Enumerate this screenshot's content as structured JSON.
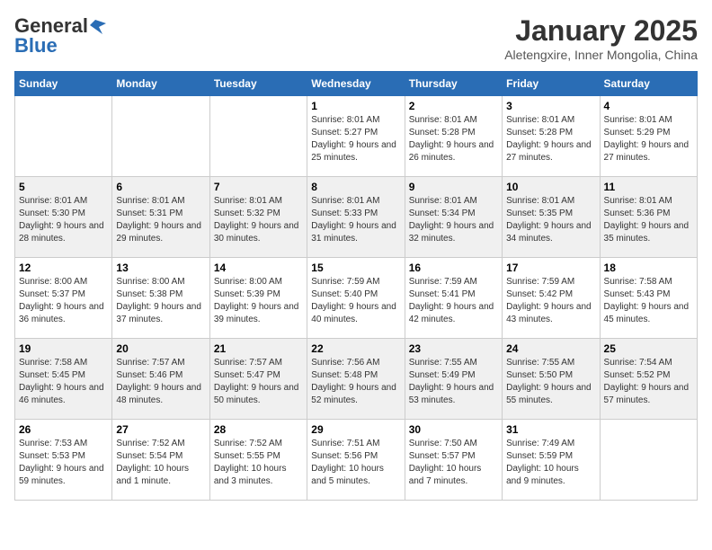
{
  "header": {
    "logo_general": "General",
    "logo_blue": "Blue",
    "title": "January 2025",
    "subtitle": "Aletengxire, Inner Mongolia, China"
  },
  "weekdays": [
    "Sunday",
    "Monday",
    "Tuesday",
    "Wednesday",
    "Thursday",
    "Friday",
    "Saturday"
  ],
  "weeks": [
    [
      {
        "day": "",
        "sunrise": "",
        "sunset": "",
        "daylight": ""
      },
      {
        "day": "",
        "sunrise": "",
        "sunset": "",
        "daylight": ""
      },
      {
        "day": "",
        "sunrise": "",
        "sunset": "",
        "daylight": ""
      },
      {
        "day": "1",
        "sunrise": "Sunrise: 8:01 AM",
        "sunset": "Sunset: 5:27 PM",
        "daylight": "Daylight: 9 hours and 25 minutes."
      },
      {
        "day": "2",
        "sunrise": "Sunrise: 8:01 AM",
        "sunset": "Sunset: 5:28 PM",
        "daylight": "Daylight: 9 hours and 26 minutes."
      },
      {
        "day": "3",
        "sunrise": "Sunrise: 8:01 AM",
        "sunset": "Sunset: 5:28 PM",
        "daylight": "Daylight: 9 hours and 27 minutes."
      },
      {
        "day": "4",
        "sunrise": "Sunrise: 8:01 AM",
        "sunset": "Sunset: 5:29 PM",
        "daylight": "Daylight: 9 hours and 27 minutes."
      }
    ],
    [
      {
        "day": "5",
        "sunrise": "Sunrise: 8:01 AM",
        "sunset": "Sunset: 5:30 PM",
        "daylight": "Daylight: 9 hours and 28 minutes."
      },
      {
        "day": "6",
        "sunrise": "Sunrise: 8:01 AM",
        "sunset": "Sunset: 5:31 PM",
        "daylight": "Daylight: 9 hours and 29 minutes."
      },
      {
        "day": "7",
        "sunrise": "Sunrise: 8:01 AM",
        "sunset": "Sunset: 5:32 PM",
        "daylight": "Daylight: 9 hours and 30 minutes."
      },
      {
        "day": "8",
        "sunrise": "Sunrise: 8:01 AM",
        "sunset": "Sunset: 5:33 PM",
        "daylight": "Daylight: 9 hours and 31 minutes."
      },
      {
        "day": "9",
        "sunrise": "Sunrise: 8:01 AM",
        "sunset": "Sunset: 5:34 PM",
        "daylight": "Daylight: 9 hours and 32 minutes."
      },
      {
        "day": "10",
        "sunrise": "Sunrise: 8:01 AM",
        "sunset": "Sunset: 5:35 PM",
        "daylight": "Daylight: 9 hours and 34 minutes."
      },
      {
        "day": "11",
        "sunrise": "Sunrise: 8:01 AM",
        "sunset": "Sunset: 5:36 PM",
        "daylight": "Daylight: 9 hours and 35 minutes."
      }
    ],
    [
      {
        "day": "12",
        "sunrise": "Sunrise: 8:00 AM",
        "sunset": "Sunset: 5:37 PM",
        "daylight": "Daylight: 9 hours and 36 minutes."
      },
      {
        "day": "13",
        "sunrise": "Sunrise: 8:00 AM",
        "sunset": "Sunset: 5:38 PM",
        "daylight": "Daylight: 9 hours and 37 minutes."
      },
      {
        "day": "14",
        "sunrise": "Sunrise: 8:00 AM",
        "sunset": "Sunset: 5:39 PM",
        "daylight": "Daylight: 9 hours and 39 minutes."
      },
      {
        "day": "15",
        "sunrise": "Sunrise: 7:59 AM",
        "sunset": "Sunset: 5:40 PM",
        "daylight": "Daylight: 9 hours and 40 minutes."
      },
      {
        "day": "16",
        "sunrise": "Sunrise: 7:59 AM",
        "sunset": "Sunset: 5:41 PM",
        "daylight": "Daylight: 9 hours and 42 minutes."
      },
      {
        "day": "17",
        "sunrise": "Sunrise: 7:59 AM",
        "sunset": "Sunset: 5:42 PM",
        "daylight": "Daylight: 9 hours and 43 minutes."
      },
      {
        "day": "18",
        "sunrise": "Sunrise: 7:58 AM",
        "sunset": "Sunset: 5:43 PM",
        "daylight": "Daylight: 9 hours and 45 minutes."
      }
    ],
    [
      {
        "day": "19",
        "sunrise": "Sunrise: 7:58 AM",
        "sunset": "Sunset: 5:45 PM",
        "daylight": "Daylight: 9 hours and 46 minutes."
      },
      {
        "day": "20",
        "sunrise": "Sunrise: 7:57 AM",
        "sunset": "Sunset: 5:46 PM",
        "daylight": "Daylight: 9 hours and 48 minutes."
      },
      {
        "day": "21",
        "sunrise": "Sunrise: 7:57 AM",
        "sunset": "Sunset: 5:47 PM",
        "daylight": "Daylight: 9 hours and 50 minutes."
      },
      {
        "day": "22",
        "sunrise": "Sunrise: 7:56 AM",
        "sunset": "Sunset: 5:48 PM",
        "daylight": "Daylight: 9 hours and 52 minutes."
      },
      {
        "day": "23",
        "sunrise": "Sunrise: 7:55 AM",
        "sunset": "Sunset: 5:49 PM",
        "daylight": "Daylight: 9 hours and 53 minutes."
      },
      {
        "day": "24",
        "sunrise": "Sunrise: 7:55 AM",
        "sunset": "Sunset: 5:50 PM",
        "daylight": "Daylight: 9 hours and 55 minutes."
      },
      {
        "day": "25",
        "sunrise": "Sunrise: 7:54 AM",
        "sunset": "Sunset: 5:52 PM",
        "daylight": "Daylight: 9 hours and 57 minutes."
      }
    ],
    [
      {
        "day": "26",
        "sunrise": "Sunrise: 7:53 AM",
        "sunset": "Sunset: 5:53 PM",
        "daylight": "Daylight: 9 hours and 59 minutes."
      },
      {
        "day": "27",
        "sunrise": "Sunrise: 7:52 AM",
        "sunset": "Sunset: 5:54 PM",
        "daylight": "Daylight: 10 hours and 1 minute."
      },
      {
        "day": "28",
        "sunrise": "Sunrise: 7:52 AM",
        "sunset": "Sunset: 5:55 PM",
        "daylight": "Daylight: 10 hours and 3 minutes."
      },
      {
        "day": "29",
        "sunrise": "Sunrise: 7:51 AM",
        "sunset": "Sunset: 5:56 PM",
        "daylight": "Daylight: 10 hours and 5 minutes."
      },
      {
        "day": "30",
        "sunrise": "Sunrise: 7:50 AM",
        "sunset": "Sunset: 5:57 PM",
        "daylight": "Daylight: 10 hours and 7 minutes."
      },
      {
        "day": "31",
        "sunrise": "Sunrise: 7:49 AM",
        "sunset": "Sunset: 5:59 PM",
        "daylight": "Daylight: 10 hours and 9 minutes."
      },
      {
        "day": "",
        "sunrise": "",
        "sunset": "",
        "daylight": ""
      }
    ]
  ]
}
